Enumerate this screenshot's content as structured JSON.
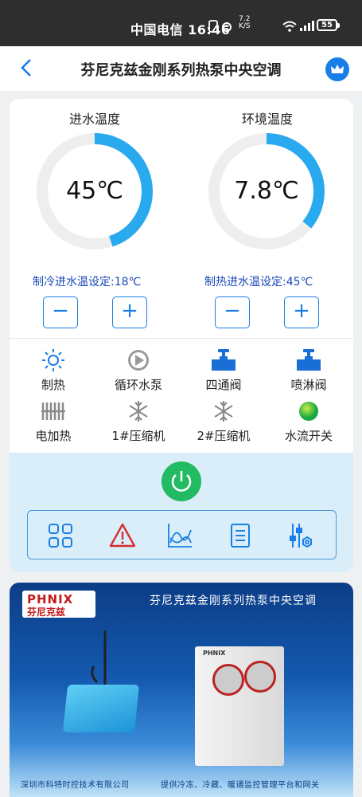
{
  "status_bar": {
    "carrier_time": "中国电信 16:46",
    "net_speed_top": "7.2",
    "net_speed_bottom": "K/S",
    "battery": "55"
  },
  "header": {
    "title": "芬尼克兹金刚系列热泵中央空调"
  },
  "gauges": [
    {
      "title": "进水温度",
      "value": "45℃",
      "level": 0.45,
      "setting": "制冷进水温设定:18℃"
    },
    {
      "title": "环境温度",
      "value": "7.8℃",
      "level": 0.36,
      "setting": "制热进水温设定:45℃"
    }
  ],
  "controls": {
    "minus": "−",
    "plus": "+"
  },
  "indicators": [
    {
      "label": "制热",
      "icon": "sun-icon"
    },
    {
      "label": "循环水泵",
      "icon": "pump-play-icon"
    },
    {
      "label": "四通阀",
      "icon": "valve-icon"
    },
    {
      "label": "喷淋阀",
      "icon": "spray-valve-icon"
    },
    {
      "label": "电加热",
      "icon": "electric-heater-icon"
    },
    {
      "label": "1#压缩机",
      "icon": "snowflake-icon"
    },
    {
      "label": "2#压缩机",
      "icon": "snowflake-icon"
    },
    {
      "label": "水流开关",
      "icon": "green-dot-icon"
    }
  ],
  "colors": {
    "accent": "#1a7ee8",
    "power": "#22ba62",
    "alarm": "#d32f2f",
    "setting_text": "#1a48b8"
  },
  "banner": {
    "logo_en": "PHNIX",
    "logo_cn": "芬尼克兹",
    "title": "芬尼克兹金刚系列热泵中央空调",
    "footer_left": "深圳市科特时控技术有限公司",
    "footer_right": "提供冷冻、冷藏、暖通监控管理平台和网关",
    "unit_brand": "PHNIX"
  }
}
